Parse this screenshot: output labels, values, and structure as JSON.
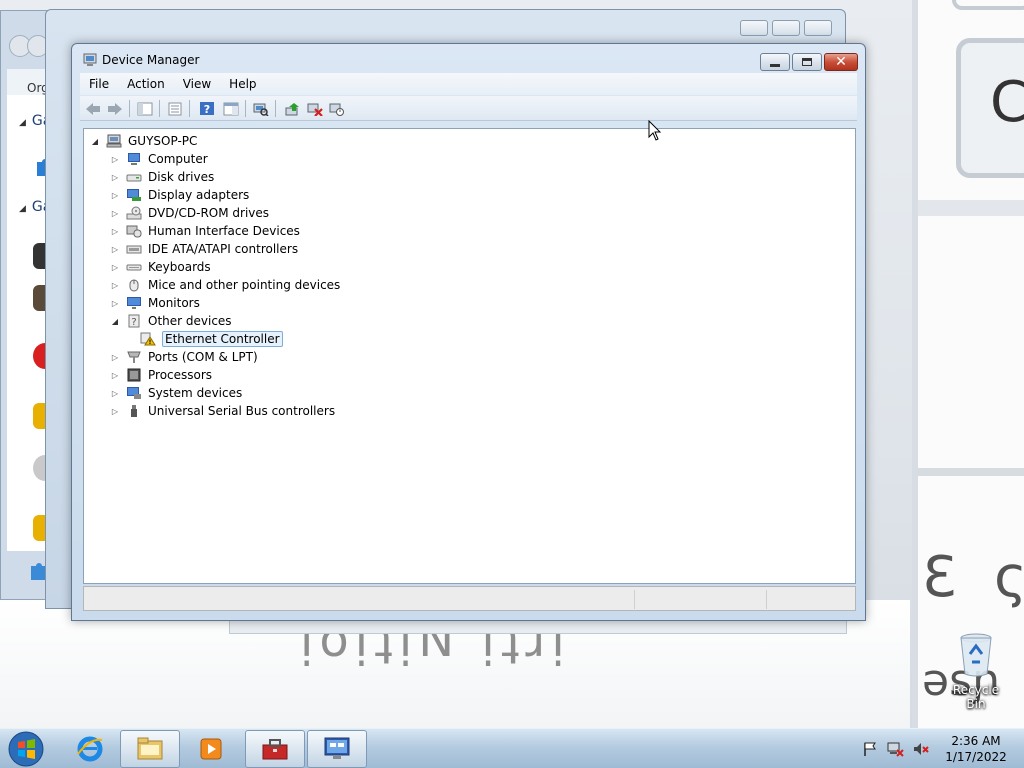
{
  "window": {
    "title": "Device Manager",
    "minimize_icon": "minimize-icon",
    "maximize_icon": "maximize-icon",
    "close_icon": "close-icon",
    "close_color": "#c8503a"
  },
  "menu": [
    "File",
    "Action",
    "View",
    "Help"
  ],
  "toolbar": {
    "buttons": [
      "back-arrow-icon",
      "forward-arrow-icon",
      "console-tree-icon",
      "properties-icon",
      "help-icon",
      "action-pane-icon",
      "scan-hardware-icon",
      "update-driver-icon",
      "uninstall-icon",
      "disable-device-icon"
    ]
  },
  "tree": {
    "root": "GUYSOP-PC",
    "categories": [
      {
        "label": "Computer",
        "icon": "computer-icon",
        "expanded": false
      },
      {
        "label": "Disk drives",
        "icon": "disk-drive-icon",
        "expanded": false
      },
      {
        "label": "Display adapters",
        "icon": "display-adapter-icon",
        "expanded": false
      },
      {
        "label": "DVD/CD-ROM drives",
        "icon": "dvd-drive-icon",
        "expanded": false
      },
      {
        "label": "Human Interface Devices",
        "icon": "hid-icon",
        "expanded": false
      },
      {
        "label": "IDE ATA/ATAPI controllers",
        "icon": "ide-controller-icon",
        "expanded": false
      },
      {
        "label": "Keyboards",
        "icon": "keyboard-icon",
        "expanded": false
      },
      {
        "label": "Mice and other pointing devices",
        "icon": "mouse-icon",
        "expanded": false
      },
      {
        "label": "Monitors",
        "icon": "monitor-icon",
        "expanded": false
      },
      {
        "label": "Other devices",
        "icon": "other-devices-icon",
        "expanded": true
      },
      {
        "label": "Ports (COM & LPT)",
        "icon": "port-icon",
        "expanded": false
      },
      {
        "label": "Processors",
        "icon": "processor-icon",
        "expanded": false
      },
      {
        "label": "System devices",
        "icon": "system-devices-icon",
        "expanded": false
      },
      {
        "label": "Universal Serial Bus controllers",
        "icon": "usb-icon",
        "expanded": false
      }
    ],
    "child": {
      "label": "Ethernet Controller",
      "icon": "warning-device-icon",
      "selected": true
    }
  },
  "background_window": {
    "toolbar_label": "Org",
    "group_label_1": "Ga",
    "group_label_2": "Ga"
  },
  "desktop": {
    "recycle_bin": "Recycle Bin"
  },
  "taskbar": {
    "start_icon": "windows-start-icon",
    "apps": [
      "internet-explorer-icon",
      "file-explorer-icon",
      "media-player-icon",
      "toolbox-icon",
      "device-manager-icon"
    ],
    "active_app": "device-manager-icon",
    "tray": [
      "action-center-flag-icon",
      "network-icon",
      "volume-muted-icon"
    ],
    "time": "2:36 AM",
    "date": "1/17/2022"
  }
}
